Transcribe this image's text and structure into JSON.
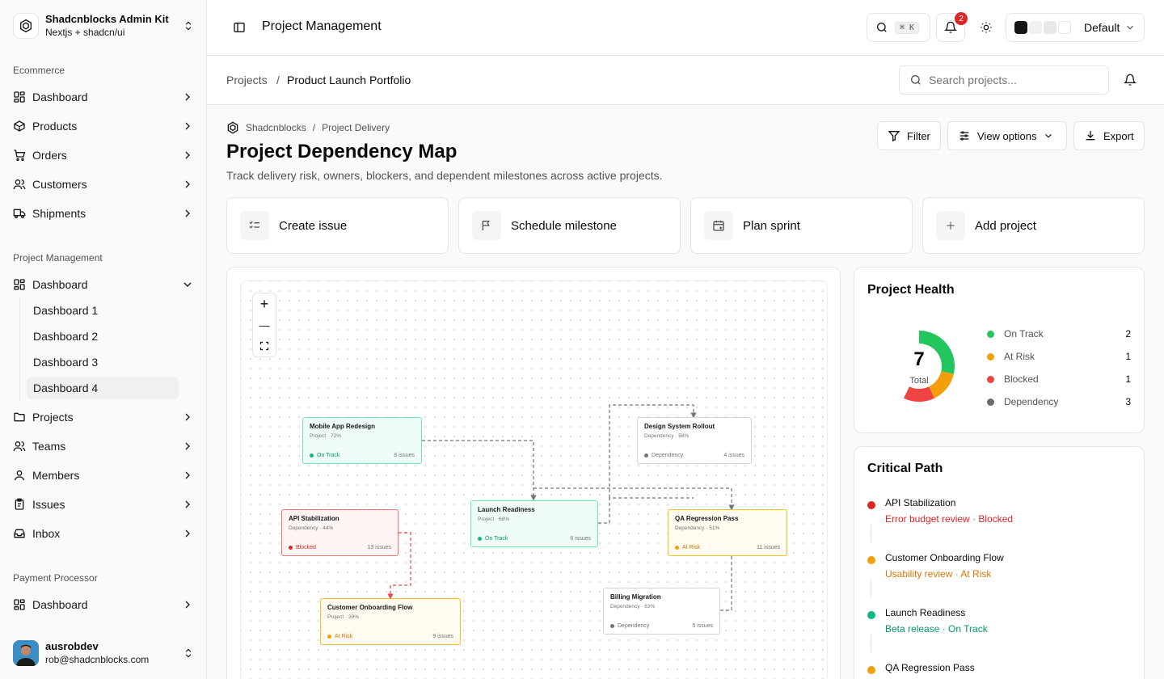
{
  "sidebar": {
    "team": {
      "name": "Shadcnblocks Admin Kit",
      "subtitle": "Nextjs + shadcn/ui"
    },
    "groups": [
      {
        "label": "Ecommerce",
        "items": [
          "Dashboard",
          "Products",
          "Orders",
          "Customers",
          "Shipments"
        ]
      },
      {
        "label": "Project Management",
        "items": [
          "Dashboard",
          "Projects",
          "Teams",
          "Members",
          "Issues",
          "Inbox"
        ],
        "subitems": [
          "Dashboard 1",
          "Dashboard 2",
          "Dashboard 3",
          "Dashboard 4"
        ],
        "active_subitem": "Dashboard 4"
      },
      {
        "label": "Payment Processor",
        "items": [
          "Dashboard"
        ]
      }
    ],
    "user": {
      "name": "ausrobdev",
      "email": "rob@shadcnblocks.com"
    }
  },
  "topbar": {
    "title": "Project Management",
    "search_shortcut": "⌘ K",
    "notification_count": "2",
    "theme_label": "Default",
    "theme_swatches": [
      "#171717",
      "#f0f0f0",
      "#e8e8e8",
      "#ffffff"
    ]
  },
  "breadcrumb": {
    "parent": "Projects",
    "separator": "/",
    "current": "Product Launch Portfolio"
  },
  "search": {
    "placeholder": "Search projects..."
  },
  "page": {
    "crumb_org": "Shadcnblocks",
    "crumb_sep": "/",
    "crumb_section": "Project Delivery",
    "title": "Project Dependency Map",
    "description": "Track delivery risk, owners, blockers, and dependent milestones across active projects.",
    "buttons": {
      "filter": "Filter",
      "view": "View options",
      "export": "Export"
    }
  },
  "quick_actions": [
    "Create issue",
    "Schedule milestone",
    "Plan sprint",
    "Add project"
  ],
  "map": {
    "controls": {
      "zoom_in": "+",
      "zoom_out": "—"
    },
    "nodes": [
      {
        "title": "Mobile App Redesign",
        "sub": "Project · 72%",
        "status": "On Track",
        "issues": "8 issues"
      },
      {
        "title": "Design System Rollout",
        "sub": "Dependency · 58%",
        "status": "Dependency",
        "issues": "4 issues"
      },
      {
        "title": "API Stabilization",
        "sub": "Dependency · 44%",
        "status": "Blocked",
        "issues": "13 issues"
      },
      {
        "title": "Launch Readiness",
        "sub": "Project · 68%",
        "status": "On Track",
        "issues": "6 issues"
      },
      {
        "title": "QA Regression Pass",
        "sub": "Dependency · 51%",
        "status": "At Risk",
        "issues": "11 issues"
      },
      {
        "title": "Customer Onboarding Flow",
        "sub": "Project · 39%",
        "status": "At Risk",
        "issues": "9 issues"
      },
      {
        "title": "Billing Migration",
        "sub": "Dependency · 63%",
        "status": "Dependency",
        "issues": "5 issues"
      }
    ]
  },
  "health": {
    "title": "Project Health",
    "total": "7",
    "total_label": "Total",
    "legend": [
      {
        "label": "On Track",
        "count": "2",
        "color": "#22c55e"
      },
      {
        "label": "At Risk",
        "count": "1",
        "color": "#f59e0b"
      },
      {
        "label": "Blocked",
        "count": "1",
        "color": "#ef4444"
      },
      {
        "label": "Dependency",
        "count": "3",
        "color": "#6b6b6b"
      }
    ]
  },
  "critical_path": {
    "title": "Critical Path",
    "items": [
      {
        "name": "API Stabilization",
        "meta": "Error budget review · Blocked",
        "color": "#dc2626"
      },
      {
        "name": "Customer Onboarding Flow",
        "meta": "Usability review · At Risk",
        "color": "#d97706"
      },
      {
        "name": "Launch Readiness",
        "meta": "Beta release · On Track",
        "color": "#059669"
      },
      {
        "name": "QA Regression Pass",
        "meta": "",
        "color": "#d97706"
      }
    ]
  }
}
